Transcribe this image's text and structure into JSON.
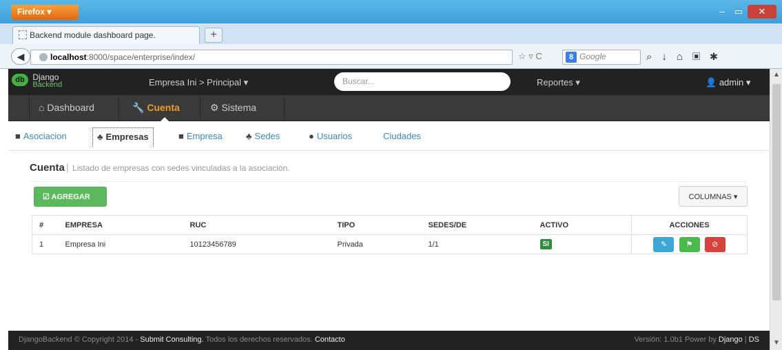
{
  "browser": {
    "menu_label": "Firefox ▾",
    "tab_title": "Backend module dashboard page.",
    "new_tab": "+",
    "url_host": "localhost",
    "url_path": ":8000/space/enterprise/index/",
    "search_engine": "Google",
    "window_controls": {
      "minimize": "–",
      "maximize": "▭",
      "close": "✕"
    }
  },
  "app": {
    "logo_line1": "Django",
    "logo_line2": "Backend",
    "logo_badge": "db",
    "company_menu": "Empresa Ini > Principal ▾",
    "search_placeholder": "Buscar...",
    "reportes": "Reportes ▾",
    "user": "admin ▾"
  },
  "subnav": {
    "dashboard": "Dashboard",
    "cuenta": "Cuenta",
    "sistema": "Sistema"
  },
  "pills": [
    {
      "label": "Asociacion",
      "icon": "briefcase-icon"
    },
    {
      "label": "Empresas",
      "icon": "sitemap-icon",
      "active": true
    },
    {
      "label": "Empresa",
      "icon": "briefcase-icon"
    },
    {
      "label": "Sedes",
      "icon": "sitemap-icon"
    },
    {
      "label": "Usuarios",
      "icon": "user-icon"
    },
    {
      "label": "Ciudades"
    }
  ],
  "page": {
    "title": "Cuenta",
    "separator": "|",
    "subtitle": "Listado de empresas con sedes vinculadas a la asociación.",
    "add_button": "AGREGAR",
    "columns_button": "COLUMNAS ▾"
  },
  "table": {
    "headers": [
      "#",
      "EMPRESA",
      "RUC",
      "TIPO",
      "SEDES/DE",
      "ACTIVO",
      "ACCIONES"
    ],
    "rows": [
      {
        "num": "1",
        "empresa": "Empresa Ini",
        "ruc": "10123456789",
        "tipo": "Privada",
        "sedes": "1/1",
        "activo": "SI"
      }
    ]
  },
  "footer": {
    "prefix": "DjangoBackend © Copyright 2014 - ",
    "company": "Submit Consulting.",
    "rights": " Todos los derechos reservados. ",
    "contact": "Contacto",
    "version": "Versión: 1.0b1 Power by ",
    "django": "Django",
    "sep": " | ",
    "ds": "DS"
  },
  "colors": {
    "accent": "#f49b1e",
    "link": "#3a87c6",
    "success": "#5cb85c",
    "danger": "#d9413b",
    "info": "#3aa7d6"
  }
}
